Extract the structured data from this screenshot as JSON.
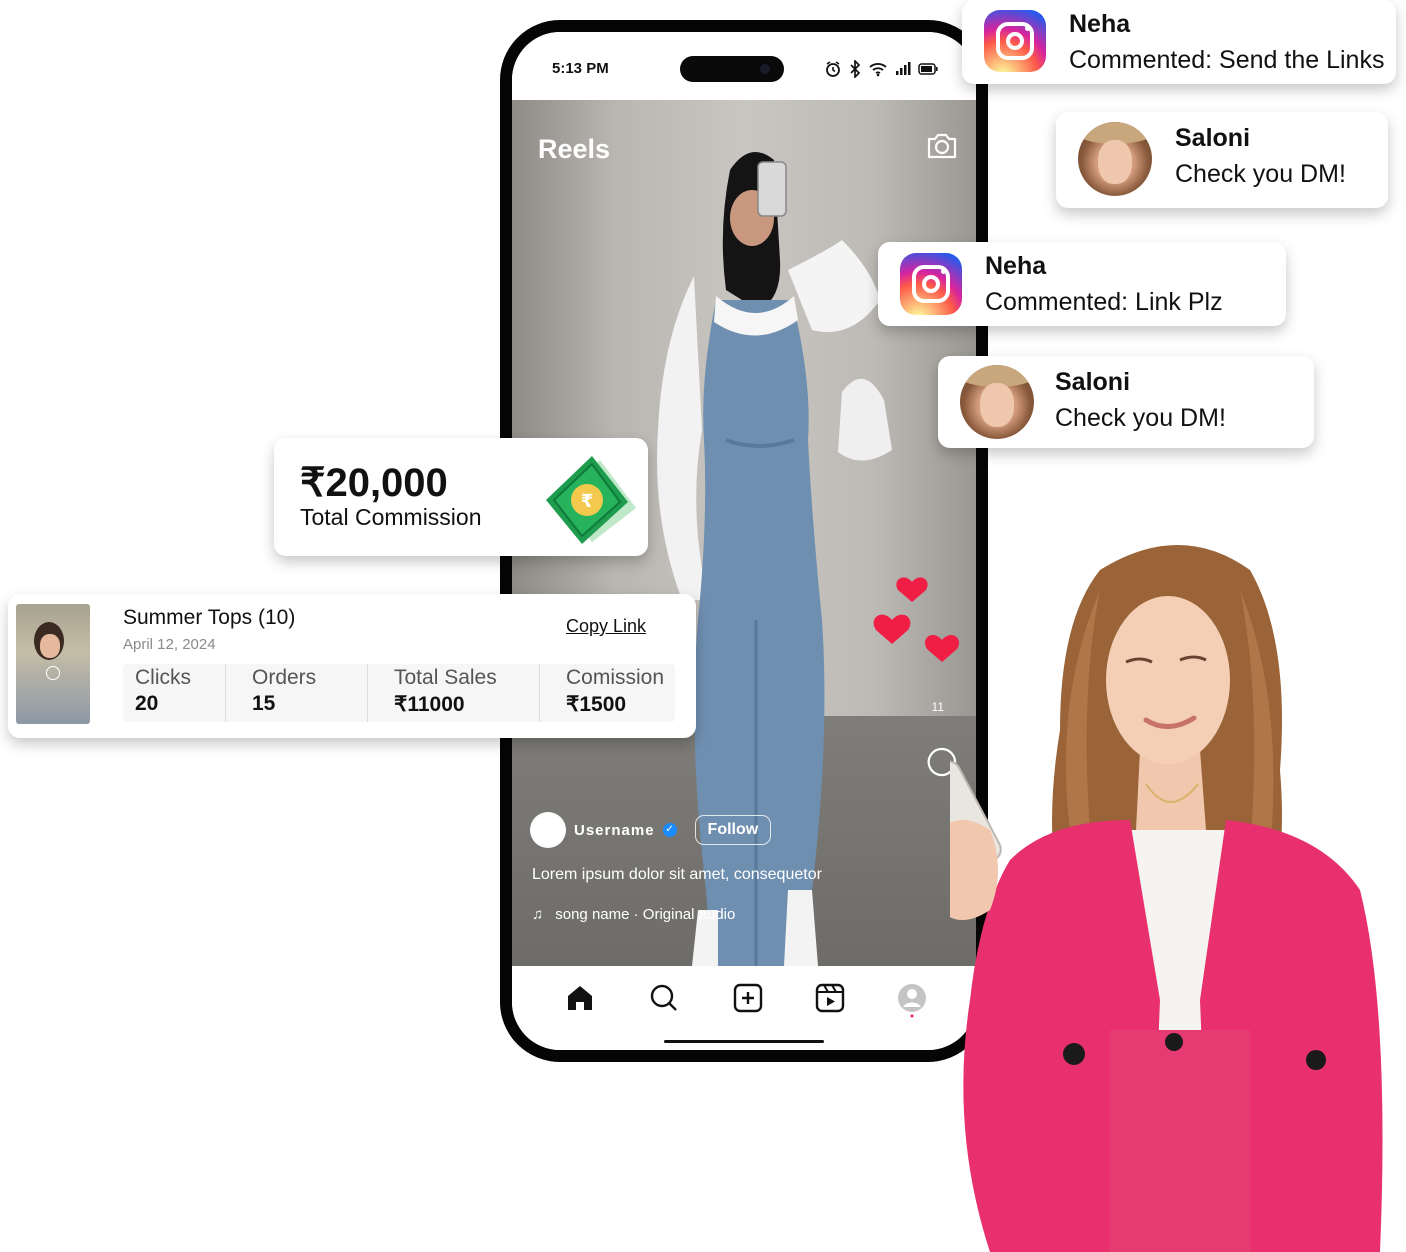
{
  "phone": {
    "time": "5:13 PM",
    "reels_title": "Reels",
    "like_count": "11",
    "username": "Username",
    "follow_label": "Follow",
    "caption": "Lorem ipsum dolor sit amet, consequetor",
    "song": "song name · Original audio"
  },
  "notifications": [
    {
      "name": "Neha",
      "message": "Commented: Send the Links",
      "icon": "instagram-icon"
    },
    {
      "name": "Saloni",
      "message": "Check you DM!",
      "icon": "avatar"
    },
    {
      "name": "Neha",
      "message": "Commented: Link Plz",
      "icon": "instagram-icon"
    },
    {
      "name": "Saloni",
      "message": "Check you DM!",
      "icon": "avatar"
    }
  ],
  "commission": {
    "amount": "₹20,000",
    "label": "Total Commission"
  },
  "campaign": {
    "title": "Summer Tops (10)",
    "date": "April 12, 2024",
    "copy_link": "Copy Link",
    "stats": [
      {
        "label": "Clicks",
        "value": "20"
      },
      {
        "label": "Orders",
        "value": "15"
      },
      {
        "label": "Total Sales",
        "value": "₹11000"
      },
      {
        "label": "Comission",
        "value": "₹1500"
      }
    ]
  },
  "colors": {
    "accent_pink": "#e8306f",
    "heart_red": "#f01d44",
    "money_green": "#1f9d4f"
  }
}
